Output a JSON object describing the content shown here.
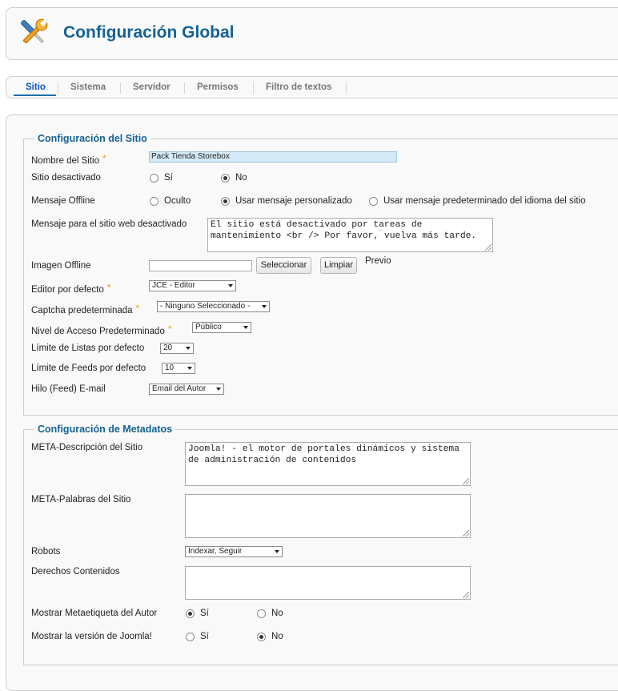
{
  "header": {
    "title": "Configuración Global",
    "logo_icon": "tools-icon"
  },
  "tabs": [
    {
      "label": "Sitio",
      "active": true
    },
    {
      "label": "Sistema"
    },
    {
      "label": "Servidor"
    },
    {
      "label": "Permisos"
    },
    {
      "label": "Filtro de textos"
    }
  ],
  "site": {
    "legend": "Configuración del Sitio",
    "site_name": {
      "label": "Nombre del Sitio",
      "value": "Pack Tienda Storebox"
    },
    "offline": {
      "label": "Sitio desactivado",
      "options": [
        "Sí",
        "No"
      ],
      "selected": "No"
    },
    "offline_message": {
      "label": "Mensaje Offline",
      "options": [
        "Oculto",
        "Usar mensaje personalizado",
        "Usar mensaje predeterminado del idioma del sitio"
      ],
      "selected": "Usar mensaje personalizado"
    },
    "custom_message": {
      "label": "Mensaje para el sitio web desactivado",
      "value": "El sitio está desactivado por tareas de mantenimiento <br /> Por favor, vuelva más tarde."
    },
    "offline_image": {
      "label": "Imagen Offline",
      "value": "",
      "select_label": "Seleccionar",
      "clear_label": "Limpiar",
      "preview_label": "Previo"
    },
    "editor": {
      "label": "Editor por defecto",
      "value": "JCE - Editor"
    },
    "captcha": {
      "label": "Captcha predeterminada",
      "value": "- Ninguno Seleccionado -"
    },
    "access": {
      "label": "Nivel de Acceso Predeterminado",
      "value": "Público"
    },
    "list_limit": {
      "label": "Límite de Listas por defecto",
      "value": "20"
    },
    "feed_limit": {
      "label": "Límite de Feeds por defecto",
      "value": "10"
    },
    "feed_email": {
      "label": "Hilo (Feed) E-mail",
      "value": "Email del Autor"
    }
  },
  "meta": {
    "legend": "Configuración de Metadatos",
    "description": {
      "label": "META-Descripción del Sitio",
      "value": "Joomla! - el motor de portales dinámicos y sistema de administración de contenidos"
    },
    "keywords": {
      "label": "META-Palabras del Sitio",
      "value": ""
    },
    "robots": {
      "label": "Robots",
      "value": "Indexar, Seguir"
    },
    "rights": {
      "label": "Derechos Contenidos",
      "value": ""
    },
    "author": {
      "label": "Mostrar Metaetiqueta del Autor",
      "options": [
        "Sí",
        "No"
      ],
      "selected": "Sí"
    },
    "version": {
      "label": "Mostrar la versión de Joomla!",
      "options": [
        "Sí",
        "No"
      ],
      "selected": "No"
    }
  },
  "colors": {
    "title_blue": "#146295",
    "active_tab": "#0b55c4",
    "required_star": "#e6a118",
    "highlight_field": "#d5eaf7"
  }
}
